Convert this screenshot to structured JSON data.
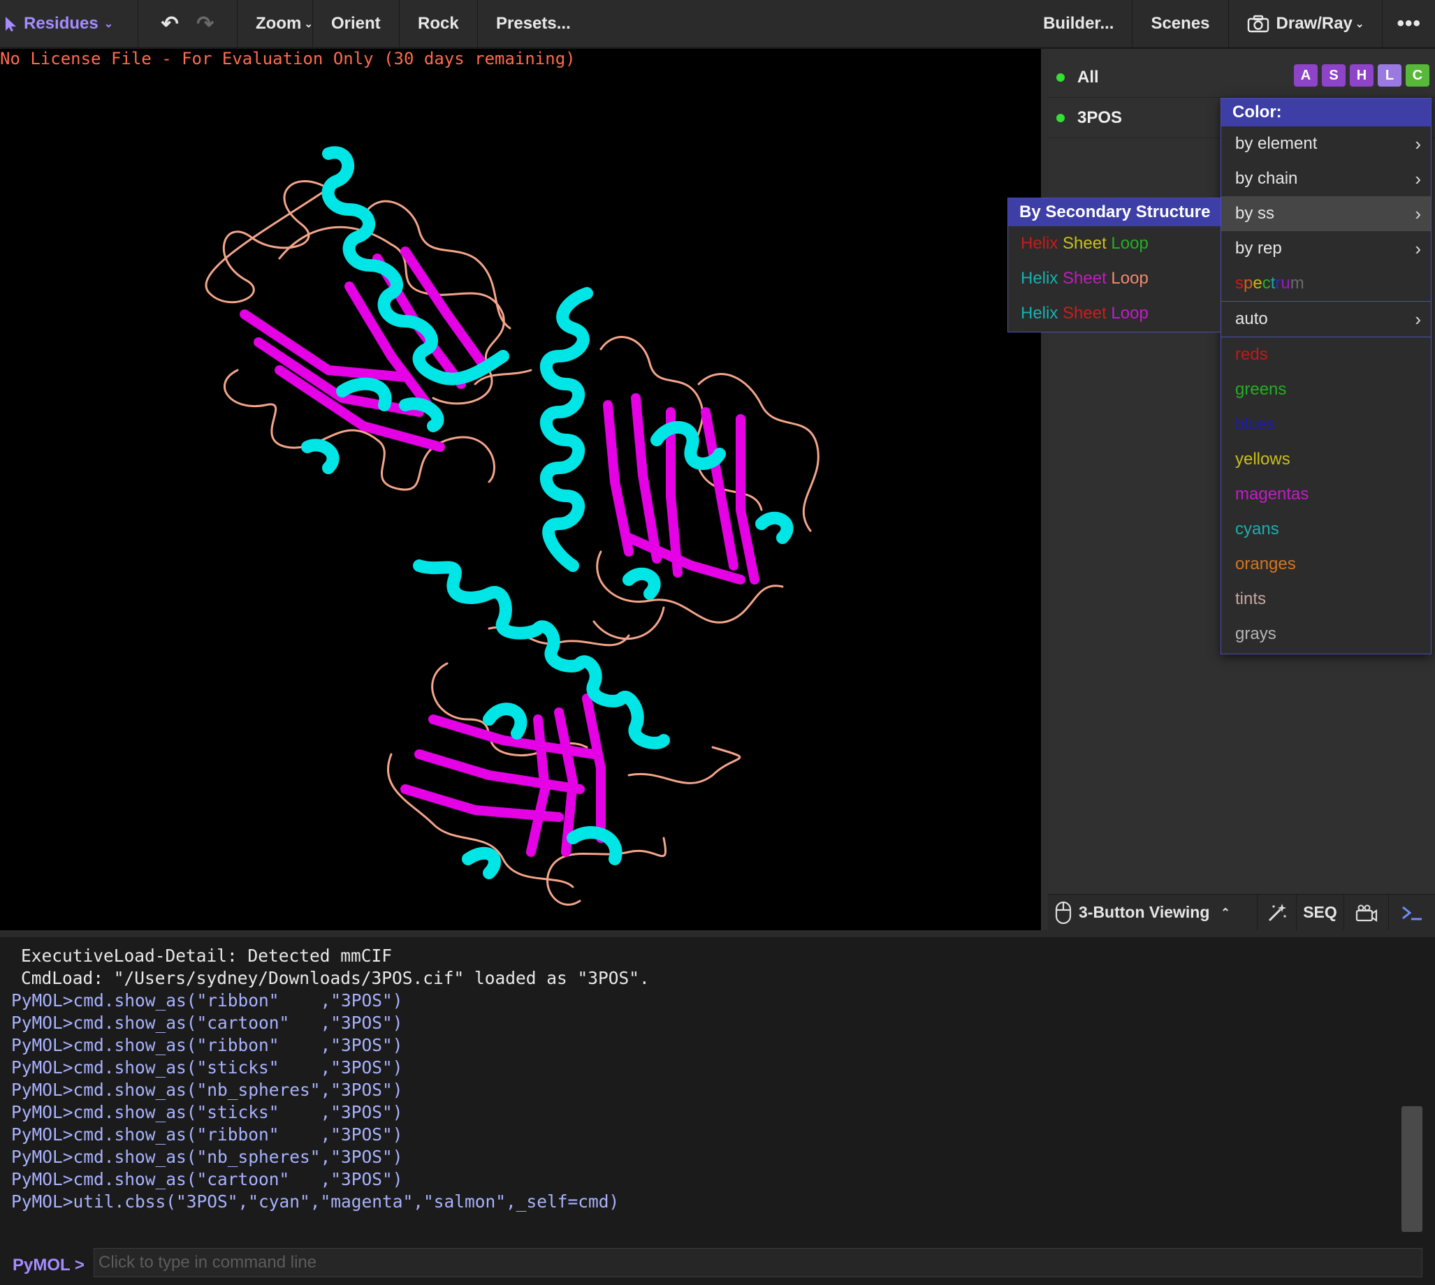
{
  "toolbar": {
    "mode_label": "Residues",
    "undo_icon": "↶",
    "redo_icon": "↷",
    "zoom": "Zoom",
    "orient": "Orient",
    "rock": "Rock",
    "presets": "Presets...",
    "builder": "Builder...",
    "scenes": "Scenes",
    "drawray": "Draw/Ray",
    "more": "•••"
  },
  "viewer": {
    "license_notice": "No License File - For Evaluation Only (30 days remaining)",
    "helix_color": "#00e6e6",
    "sheet_color": "#e600e6",
    "loop_color": "#f4a58a"
  },
  "objects": {
    "all_label": "All",
    "object_label": "3POS",
    "actions": [
      "A",
      "S",
      "H",
      "L",
      "C"
    ],
    "action_colors": [
      "#8e44c9",
      "#8e44c9",
      "#8e44c9",
      "#9a7ae0",
      "#58b83a"
    ]
  },
  "color_menu": {
    "title": "Color:",
    "items": {
      "by_element": "by element",
      "by_chain": "by chain",
      "by_ss": "by ss",
      "by_rep": "by rep",
      "spectrum": "spectrum",
      "auto": "auto",
      "reds": "reds",
      "greens": "greens",
      "blues": "blues",
      "yellows": "yellows",
      "magentas": "magentas",
      "cyans": "cyans",
      "oranges": "oranges",
      "tints": "tints",
      "grays": "grays"
    }
  },
  "ss_submenu": {
    "title": "By Secondary Structure",
    "schemes": [
      {
        "helix": "Helix",
        "sheet": "Sheet",
        "loop": "Loop",
        "colors": [
          "#c61b1b",
          "#c9c11a",
          "#22b022"
        ]
      },
      {
        "helix": "Helix",
        "sheet": "Sheet",
        "loop": "Loop",
        "colors": [
          "#19b0b0",
          "#c01cc0",
          "#f08a70"
        ]
      },
      {
        "helix": "Helix",
        "sheet": "Sheet",
        "loop": "Loop",
        "colors": [
          "#19b0b0",
          "#d11a1a",
          "#c21cc8"
        ]
      }
    ]
  },
  "mouse_bar": {
    "mode": "3-Button Viewing",
    "seq": "SEQ"
  },
  "console": {
    "lines": [
      "ExecutiveLoad-Detail: Detected mmCIF",
      "CmdLoad: \"/Users/sydney/Downloads/3POS.cif\" loaded as \"3POS\".",
      "PyMOL>cmd.show_as(\"ribbon\"    ,\"3POS\")",
      "PyMOL>cmd.show_as(\"cartoon\"   ,\"3POS\")",
      "PyMOL>cmd.show_as(\"ribbon\"    ,\"3POS\")",
      "PyMOL>cmd.show_as(\"sticks\"    ,\"3POS\")",
      "PyMOL>cmd.show_as(\"nb_spheres\",\"3POS\")",
      "PyMOL>cmd.show_as(\"sticks\"    ,\"3POS\")",
      "PyMOL>cmd.show_as(\"ribbon\"    ,\"3POS\")",
      "PyMOL>cmd.show_as(\"nb_spheres\",\"3POS\")",
      "PyMOL>cmd.show_as(\"cartoon\"   ,\"3POS\")",
      "PyMOL>util.cbss(\"3POS\",\"cyan\",\"magenta\",\"salmon\",_self=cmd)"
    ],
    "prompt": "PyMOL >",
    "placeholder": "Click to type in command line"
  }
}
